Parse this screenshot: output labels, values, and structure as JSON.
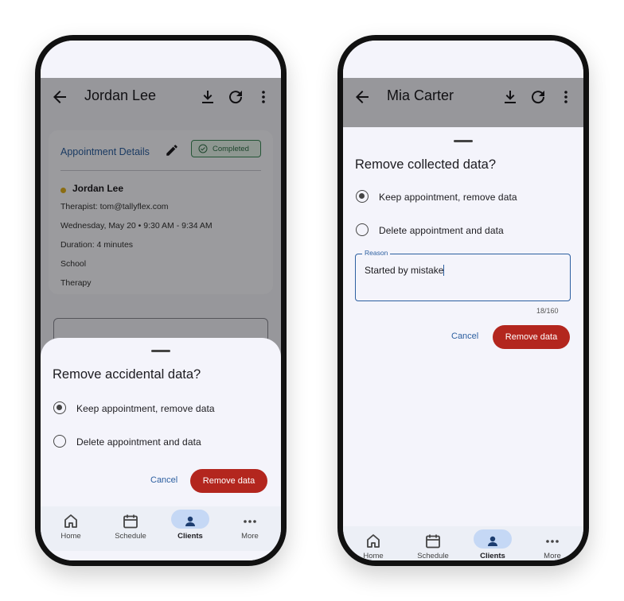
{
  "phone1": {
    "appbar": {
      "title": "Jordan Lee"
    },
    "card": {
      "title": "Appointment Details",
      "badge": "Completed",
      "client_name": "Jordan Lee",
      "rows": [
        "Therapist: tom@tallyflex.com",
        "Wednesday, May 20 • 9:30 AM - 9:34 AM",
        "Duration: 4 minutes",
        "School",
        "Therapy"
      ],
      "status_color": "#e0b020"
    },
    "sheet": {
      "title": "Remove accidental data?",
      "options": [
        {
          "label": "Keep appointment, remove data",
          "selected": true
        },
        {
          "label": "Delete appointment and data",
          "selected": false
        }
      ],
      "cancel_label": "Cancel",
      "remove_label": "Remove data"
    }
  },
  "phone2": {
    "appbar": {
      "title": "Mia Carter"
    },
    "sheet": {
      "title": "Remove collected data?",
      "options": [
        {
          "label": "Keep appointment, remove data",
          "selected": true
        },
        {
          "label": "Delete appointment and data",
          "selected": false
        }
      ],
      "reason_label": "Reason",
      "reason_value": "Started by mistake",
      "counter": "18/160",
      "cancel_label": "Cancel",
      "remove_label": "Remove data"
    }
  },
  "nav": [
    {
      "label": "Home",
      "icon": "home-icon",
      "active": false
    },
    {
      "label": "Schedule",
      "icon": "calendar-icon",
      "active": false
    },
    {
      "label": "Clients",
      "icon": "person-icon",
      "active": true
    },
    {
      "label": "More",
      "icon": "more-horizontal-icon",
      "active": false
    }
  ],
  "colors": {
    "accent_blue": "#2c5fa0",
    "remove_button": "#b3261e",
    "nav_active_pill": "#c5d8f5",
    "badge_green": "#3d8a5a"
  }
}
